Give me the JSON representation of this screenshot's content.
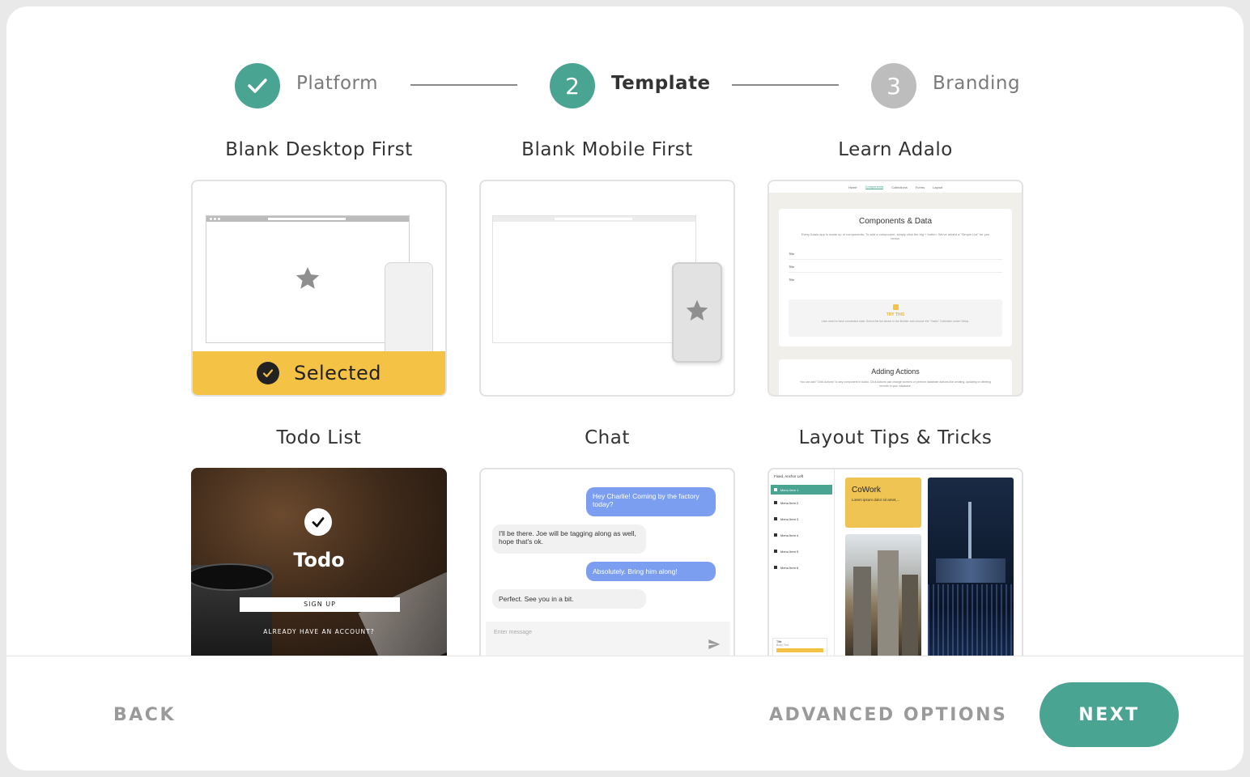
{
  "stepper": {
    "steps": [
      {
        "number": "",
        "label": "Platform",
        "state": "complete"
      },
      {
        "number": "2",
        "label": "Template",
        "state": "active"
      },
      {
        "number": "3",
        "label": "Branding",
        "state": "upcoming"
      }
    ]
  },
  "colors": {
    "accent": "#4aa492",
    "selected": "#f4c244",
    "inactive": "#bdbdbd"
  },
  "templates": [
    {
      "title": "Blank Desktop First",
      "selected": true,
      "selected_label": "Selected"
    },
    {
      "title": "Blank Mobile First"
    },
    {
      "title": "Learn Adalo",
      "preview": {
        "tabs": [
          "Home",
          "Components",
          "Collections",
          "Forms",
          "Layout"
        ],
        "heading": "Components & Data",
        "description": "Every Adalo app is made up of components. To add a component, simply click the big + button. We've added a \"Simple List\" for you below.",
        "list_items": [
          "Title",
          "Title",
          "Title"
        ],
        "try_label": "TRY THIS",
        "try_text": "Lists need to have connected data. Select the list above in the Builder and choose the \"Tasks\" Collection under Setup.",
        "heading2": "Adding Actions",
        "description2": "You can add \"Click Actions\" to any component in Adalo. Click Actions can change screens or perform database actions like creating, updating or deleting records in your database."
      }
    },
    {
      "title": "Todo List",
      "preview": {
        "app_name": "Todo",
        "signup": "SIGN UP",
        "login": "ALREADY HAVE AN ACCOUNT?"
      }
    },
    {
      "title": "Chat",
      "preview": {
        "messages": [
          {
            "text": "Hey Charlie! Coming by the factory today?",
            "from": "me"
          },
          {
            "text": "I'll be there. Joe will be tagging along as well, hope that's ok.",
            "from": "them"
          },
          {
            "text": "Absolutely. Bring him along!",
            "from": "me"
          },
          {
            "text": "Perfect. See you in a bit.",
            "from": "them"
          }
        ],
        "input_placeholder": "Enter message"
      }
    },
    {
      "title": "Layout Tips & Tricks",
      "preview": {
        "header": "Fixed, Anchor Left",
        "menu": [
          "Menu Item 1",
          "Menu Item 2",
          "Menu Item 3",
          "Menu Item 4",
          "Menu Item 5",
          "Menu Item 6"
        ],
        "footer_title": "Title",
        "footer_sub": "Body Text",
        "card_title": "CoWork",
        "card_text": "Lorem ipsum dolor sit amet,..."
      }
    }
  ],
  "footer": {
    "back": "BACK",
    "advanced": "ADVANCED OPTIONS",
    "next": "NEXT"
  }
}
